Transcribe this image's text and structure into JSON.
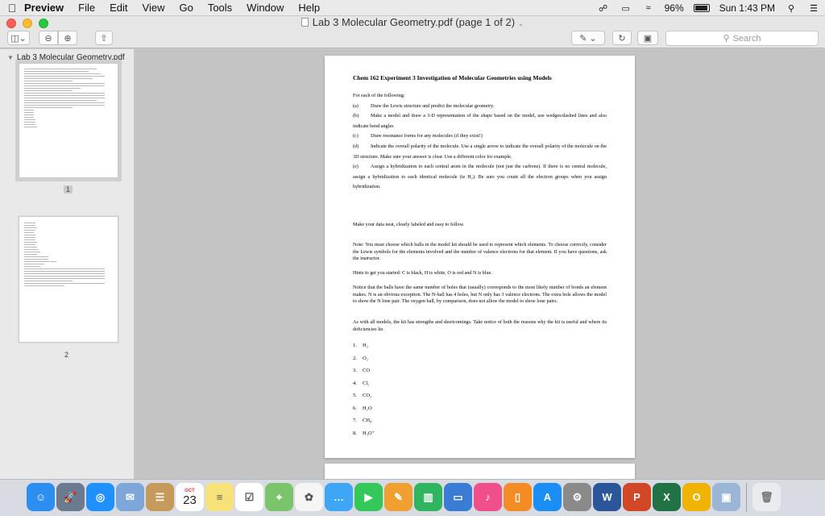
{
  "menubar": {
    "app": "Preview",
    "menus": [
      "File",
      "Edit",
      "View",
      "Go",
      "Tools",
      "Window",
      "Help"
    ],
    "battery": "96%",
    "clock": "Sun 1:43 PM"
  },
  "window": {
    "title": "Lab 3 Molecular Geometry.pdf (page 1 of 2)"
  },
  "toolbar": {
    "search_placeholder": "Search"
  },
  "sidebar": {
    "filename": "Lab 3 Molecular Geometry.pdf",
    "pages": [
      {
        "label": "1",
        "selected": true
      },
      {
        "label": "2",
        "selected": false
      }
    ]
  },
  "document": {
    "title": "Chem 162 Experiment 3 Investigation of Molecular Geometries using Models",
    "intro": "For each of the following:",
    "tasks": [
      {
        "label": "(a)",
        "text": "Draw the Lewis structure and predict the molecular geometry."
      },
      {
        "label": "(b)",
        "text": "Make a model and draw a 3-D representation of the shape based on the model, use wedges/dashed lines and also indicate bend angles"
      },
      {
        "label": "(c)",
        "text": "Draw resonance forms for any molecules (if they exist!)"
      },
      {
        "label": "(d)",
        "text": "Indicate the overall polarity of the molecule. Use a single arrow to indicate the overall polarity of the molecule on the 3D structure. Make sure your answer is clear. Use a different color for example."
      },
      {
        "label": "(e)",
        "text": "Assign a hybridization to each central atom in the molecule (not just the carbons). If there is no central molecule, assign a hybridization to each identical molecule (ie H₂). Be sure you count all the electron groups when you assign hybridization."
      }
    ],
    "data_note": "Make your data neat, clearly labeled and easy to follow.",
    "note": "Note: You must choose which balls in the model kit should be used to represent which elements. To choose correctly, consider the Lewis symbols for the elements involved and the number of valence electrons for that element. If you have questions, ask the instructor.",
    "hints": "Hints to get you started: C is black, H is white, O is red and N is blue.",
    "notice": "Notice that the balls have the same number of holes that (usually) corresponds to the most likely number of bonds an element makes. N is an obvious exception. The N-ball has 4 holes, but N only has 3 valence electrons. The extra hole allows the model to show the N lone pair. The oxygen ball, by comparison, does not allow the model to show lone pairs.",
    "models": "As with all models, the kit has strengths and shortcomings. Take notice of both the reasons why the kit is useful and where its deficiencies lie.",
    "molecules": [
      {
        "n": "1.",
        "f": "H₂"
      },
      {
        "n": "2.",
        "f": "O₂"
      },
      {
        "n": "3.",
        "f": "CO"
      },
      {
        "n": "4.",
        "f": "Cl₂"
      },
      {
        "n": "5.",
        "f": "CO₂"
      },
      {
        "n": "6.",
        "f": "H₂O"
      },
      {
        "n": "7.",
        "f": "CH₄"
      },
      {
        "n": "8.",
        "f": "H₃O⁺"
      }
    ]
  },
  "dock": {
    "calendar_month": "OCT",
    "calendar_day": "23",
    "apps": [
      {
        "name": "finder-icon",
        "color": "#2b8ef0"
      },
      {
        "name": "launchpad-icon",
        "color": "#6b7a8f"
      },
      {
        "name": "safari-icon",
        "color": "#1e90ff"
      },
      {
        "name": "mail-icon",
        "color": "#7da7d9"
      },
      {
        "name": "contacts-icon",
        "color": "#c69a5a"
      },
      {
        "name": "calendar-icon",
        "color": "#ffffff"
      },
      {
        "name": "notes-icon",
        "color": "#f7e27a"
      },
      {
        "name": "reminders-icon",
        "color": "#ffffff"
      },
      {
        "name": "maps-icon",
        "color": "#7cc46b"
      },
      {
        "name": "photos-icon",
        "color": "#f5f5f5"
      },
      {
        "name": "messages-icon",
        "color": "#3fa6f5"
      },
      {
        "name": "facetime-icon",
        "color": "#34c759"
      },
      {
        "name": "pages-icon",
        "color": "#f0a030"
      },
      {
        "name": "numbers-icon",
        "color": "#2fb55f"
      },
      {
        "name": "keynote-icon",
        "color": "#3a7bd5"
      },
      {
        "name": "itunes-icon",
        "color": "#f04f8c"
      },
      {
        "name": "ibooks-icon",
        "color": "#f48c26"
      },
      {
        "name": "app-store-icon",
        "color": "#1a8ef5"
      },
      {
        "name": "system-preferences-icon",
        "color": "#8a8a8a"
      },
      {
        "name": "word-icon",
        "color": "#2b579a"
      },
      {
        "name": "powerpoint-icon",
        "color": "#d24726"
      },
      {
        "name": "excel-icon",
        "color": "#217346"
      },
      {
        "name": "outlook-icon",
        "color": "#f0b400"
      },
      {
        "name": "preview-icon",
        "color": "#9ab5d6"
      }
    ]
  }
}
